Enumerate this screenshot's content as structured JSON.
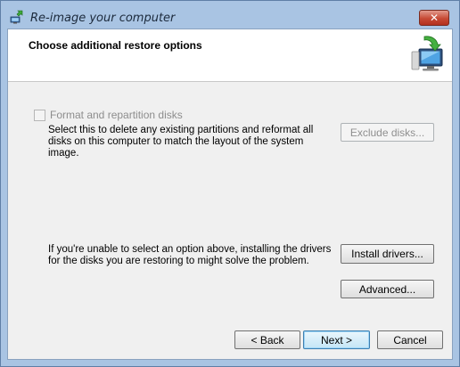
{
  "window": {
    "title": "Re-image your computer",
    "close_glyph": "✕"
  },
  "header": {
    "title": "Choose additional restore options",
    "icon": "monitor-restore-icon"
  },
  "format_option": {
    "checkbox_label": "Format and repartition disks",
    "checked": false,
    "enabled": false,
    "description": "Select this to delete any existing partitions and reformat all disks on this computer to match the layout of the system image.",
    "exclude_button": "Exclude disks..."
  },
  "drivers": {
    "description": "If you're unable to select an option above, installing the drivers for the disks you are restoring to might solve the problem.",
    "install_button": "Install drivers...",
    "advanced_button": "Advanced..."
  },
  "footer": {
    "back_button": "< Back",
    "next_button": "Next >",
    "cancel_button": "Cancel"
  },
  "colors": {
    "frame": "#a9c4e3",
    "close_button": "#c74a35",
    "default_button_border": "#3c7fb1"
  }
}
